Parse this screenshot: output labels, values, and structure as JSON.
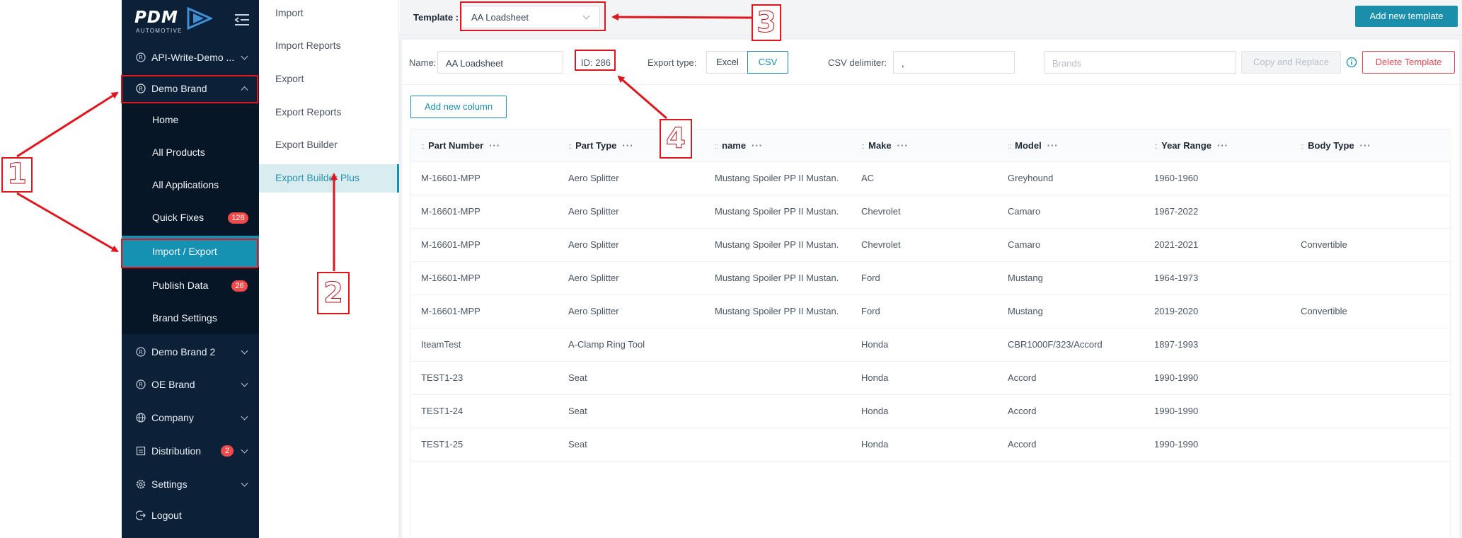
{
  "sidebar": {
    "logo_text": "PDM",
    "logo_sub": "AUTOMOTIVE",
    "items": {
      "api": {
        "label": "API-Write-Demo ...",
        "icon": "registered-icon"
      },
      "demo_brand": {
        "label": "Demo Brand",
        "icon": "registered-icon"
      },
      "demo_brand_2": {
        "label": "Demo Brand 2",
        "icon": "registered-icon"
      },
      "oe_brand": {
        "label": "OE Brand",
        "icon": "registered-icon"
      },
      "company": {
        "label": "Company",
        "icon": "globe-icon"
      },
      "distribution": {
        "label": "Distribution",
        "icon": "box-icon",
        "badge": "2"
      },
      "settings": {
        "label": "Settings",
        "icon": "gear-icon"
      },
      "logout": {
        "label": "Logout",
        "icon": "logout-icon"
      }
    },
    "sub_items": {
      "home": "Home",
      "all_products": "All Products",
      "all_applications": "All Applications",
      "quick_fixes": {
        "label": "Quick Fixes",
        "badge": "128"
      },
      "import_export": "Import / Export",
      "publish_data": {
        "label": "Publish Data",
        "badge": "26"
      },
      "brand_settings": "Brand Settings"
    }
  },
  "subnav": {
    "import": "Import",
    "import_reports": "Import Reports",
    "export": "Export",
    "export_reports": "Export Reports",
    "export_builder": "Export Builder",
    "export_builder_plus": "Export Builder Plus"
  },
  "topbar": {
    "template_label": "Template :",
    "template_value": "AA Loadsheet",
    "add_template": "Add new template"
  },
  "filters": {
    "name_label": "Name:",
    "name_value": "AA Loadsheet",
    "id_text": "ID: 286",
    "export_type_label": "Export type:",
    "excel": "Excel",
    "csv": "CSV",
    "csv_delim_label": "CSV delimiter:",
    "csv_delim_value": ",",
    "brands_placeholder": "Brands",
    "copy_replace": "Copy and Replace",
    "delete_template": "Delete Template",
    "add_column": "Add new column"
  },
  "table": {
    "columns": [
      "Part Number",
      "Part Type",
      "name",
      "Make",
      "Model",
      "Year Range",
      "Body Type"
    ],
    "rows": [
      [
        "M-16601-MPP",
        "Aero Splitter",
        "Mustang Spoiler PP II Mustan...",
        "AC",
        "Greyhound",
        "1960-1960",
        ""
      ],
      [
        "M-16601-MPP",
        "Aero Splitter",
        "Mustang Spoiler PP II Mustan...",
        "Chevrolet",
        "Camaro",
        "1967-2022",
        ""
      ],
      [
        "M-16601-MPP",
        "Aero Splitter",
        "Mustang Spoiler PP II Mustan...",
        "Chevrolet",
        "Camaro",
        "2021-2021",
        "Convertible"
      ],
      [
        "M-16601-MPP",
        "Aero Splitter",
        "Mustang Spoiler PP II Mustan...",
        "Ford",
        "Mustang",
        "1964-1973",
        ""
      ],
      [
        "M-16601-MPP",
        "Aero Splitter",
        "Mustang Spoiler PP II Mustan...",
        "Ford",
        "Mustang",
        "2019-2020",
        "Convertible"
      ],
      [
        "IteamTest",
        "A-Clamp Ring Tool",
        "",
        "Honda",
        "CBR1000F/323/Accord",
        "1897-1993",
        ""
      ],
      [
        "TEST1-23",
        "Seat",
        "",
        "Honda",
        "Accord",
        "1990-1990",
        ""
      ],
      [
        "TEST1-24",
        "Seat",
        "",
        "Honda",
        "Accord",
        "1990-1990",
        ""
      ],
      [
        "TEST1-25",
        "Seat",
        "",
        "Honda",
        "Accord",
        "1990-1990",
        ""
      ]
    ]
  },
  "annotations": {
    "c1": "1",
    "c2": "2",
    "c3": "3",
    "c4": "4"
  },
  "colors": {
    "sidebar_bg": "#0c2138",
    "accent": "#1a8eab",
    "annotation_red": "#e0161e",
    "badge_red": "#f04a4a"
  }
}
